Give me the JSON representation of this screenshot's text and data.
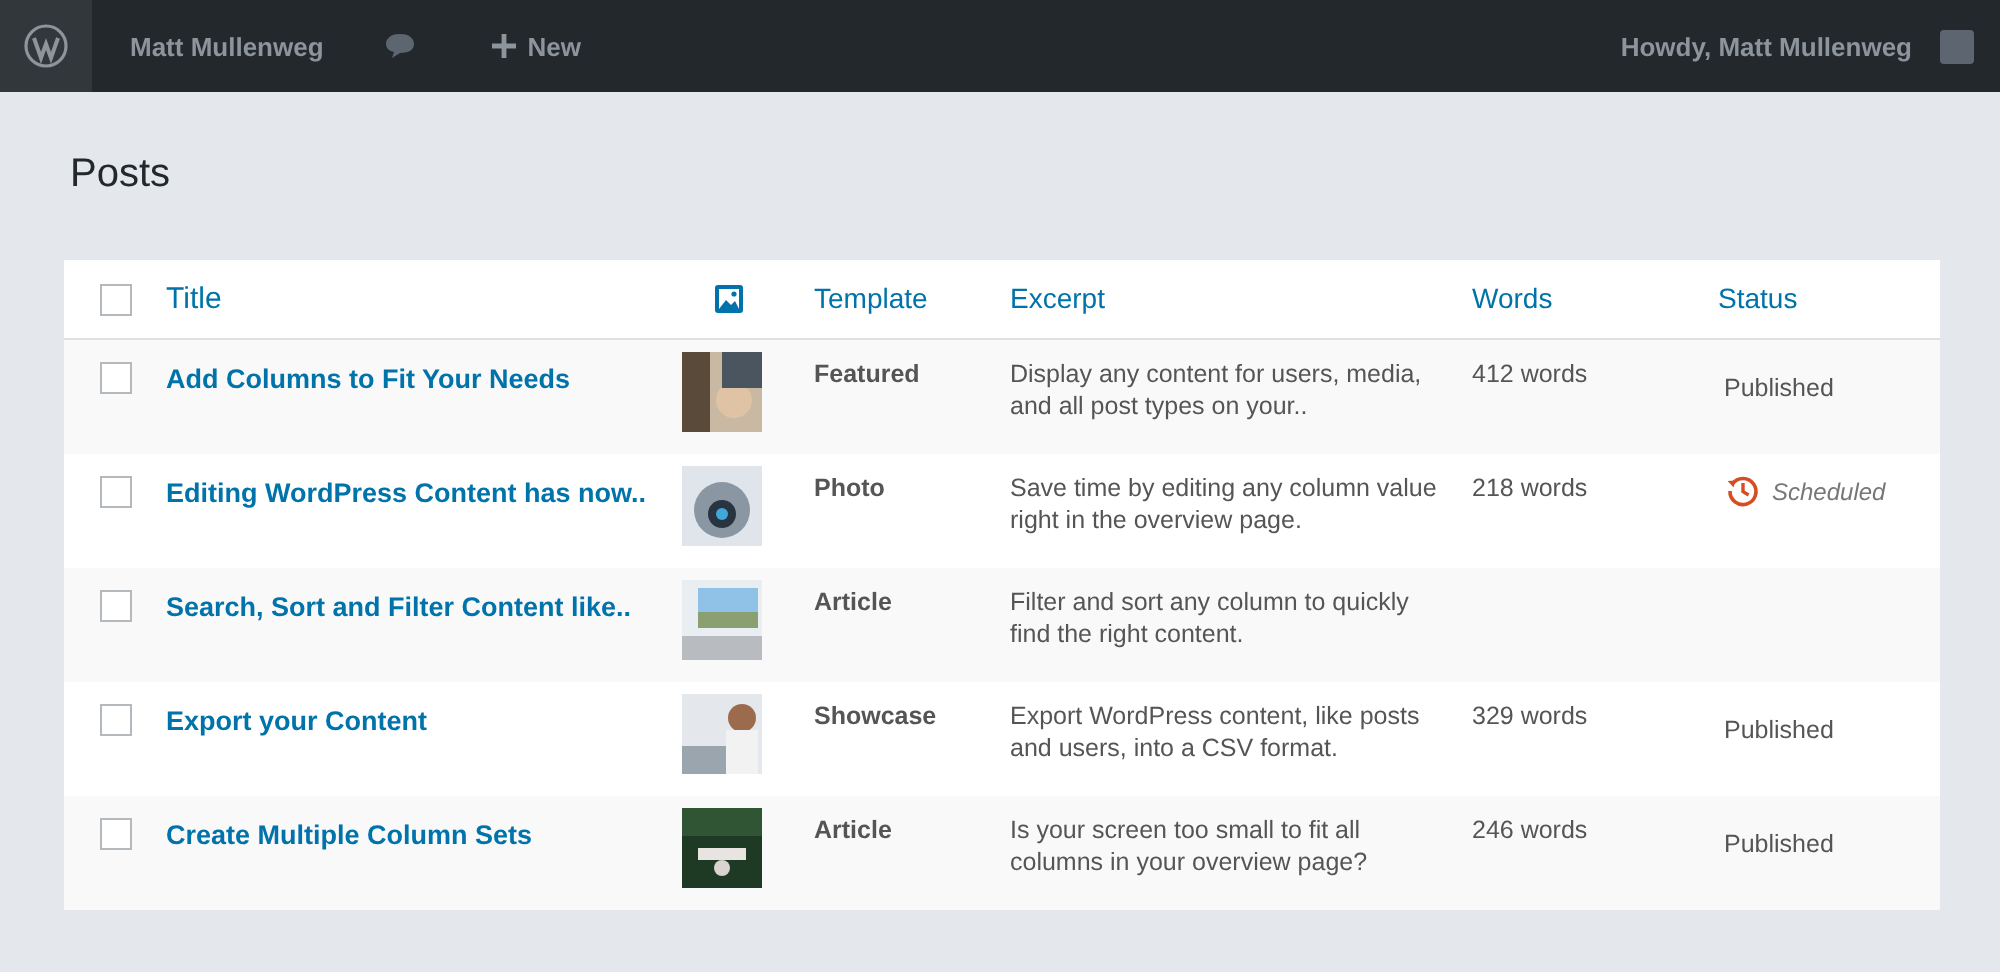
{
  "top_bar": {
    "site_name": "Matt Mullenweg",
    "new_label": "New",
    "greeting": "Howdy,  Matt Mullenweg"
  },
  "page_title": "Posts",
  "table": {
    "select_all": {
      "checked": false
    },
    "columns": {
      "title": "Title",
      "template": "Template",
      "excerpt": "Excerpt",
      "words": "Words",
      "status": "Status"
    },
    "rows": [
      {
        "checked": false,
        "title": "Add Columns to Fit Your Needs",
        "template": "Featured",
        "excerpt": "Display any content for users, media, and all post types on your..",
        "words": "412 words",
        "status": {
          "kind": "published",
          "label": "Published"
        }
      },
      {
        "checked": false,
        "title": "Editing WordPress Content has now..",
        "template": "Photo",
        "excerpt": "Save time by editing any column value right in the overview page.",
        "words": "218 words",
        "status": {
          "kind": "scheduled",
          "label": "Scheduled"
        }
      },
      {
        "checked": false,
        "title": "Search, Sort and Filter Content like..",
        "template": "Article",
        "excerpt": "Filter and sort any column to quickly find the right content."
      },
      {
        "checked": false,
        "title": "Export your Content",
        "template": "Showcase",
        "excerpt": "Export WordPress content, like posts and users, into a CSV format.",
        "words": "329 words",
        "status": {
          "kind": "published",
          "label": "Published"
        }
      },
      {
        "checked": false,
        "title": "Create Multiple Column Sets",
        "template": "Article",
        "excerpt": "Is your screen too small to fit all columns in your overview page?",
        "words": "246 words",
        "status": {
          "kind": "published",
          "label": "Published"
        }
      }
    ]
  }
}
